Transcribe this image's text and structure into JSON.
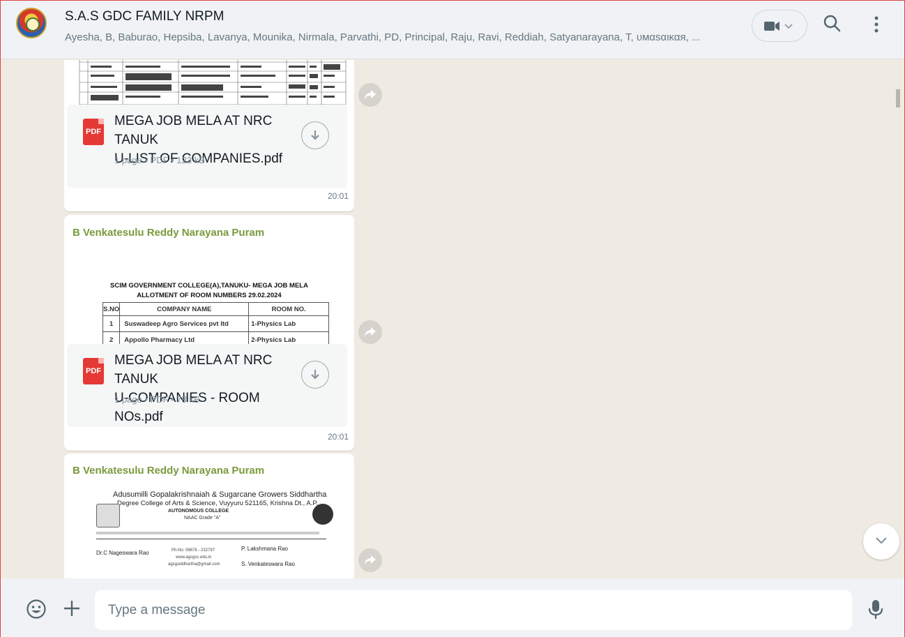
{
  "header": {
    "title": "S.A.S GDC FAMILY NRPM",
    "members": "Ayesha, B, Baburao, Hepsiba, Lavanya, Mounika, Nirmala, Parvathi, PD, Principal, Raju, Ravi, Reddiah, Satyanarayana, T, υмαsαικαя, ...",
    "icons": {
      "video": "video-camera-icon",
      "search": "search-icon",
      "menu": "kebab-menu-icon"
    }
  },
  "messages": [
    {
      "document": {
        "name_line1": "MEGA JOB MELA AT NRC TANUK",
        "name_line2": "U-LIST OF COMPANIES.pdf",
        "meta": "1 page • PDF • 123 kB",
        "badge": "PDF"
      },
      "time": "20:01"
    },
    {
      "sender": "B Venkatesulu Reddy Narayana Puram",
      "preview": {
        "heading1": "SCIM GOVERNMENT COLLEGE(A),TANUKU- MEGA JOB MELA",
        "heading2": "ALLOTMENT OF ROOM NUMBERS 29.02.2024",
        "col_sno": "S.NO",
        "col_company": "COMPANY NAME",
        "col_room": "ROOM NO.",
        "rows": [
          {
            "sno": "1",
            "company": "Suswadeep Agro Services pvt ltd",
            "room": "1-Physics Lab"
          },
          {
            "sno": "2",
            "company": "Appollo Pharmacy Ltd",
            "room": "2-Physics Lab"
          }
        ]
      },
      "document": {
        "name_line1": "MEGA JOB MELA AT NRC TANUK",
        "name_line2": "U-COMPANIES - ROOM NOs.pdf",
        "meta": "1 page • PDF • 78 kB",
        "badge": "PDF"
      },
      "time": "20:01"
    },
    {
      "sender": "B Venkatesulu Reddy Narayana Puram",
      "preview": {
        "line1": "Adusumilli Gopalakrishnaiah & Sugarcane Growers Siddhartha",
        "line2": "Degree College of Arts & Science, Vuyyuru 521165, Krishna Dt., A.P.",
        "line3": "AUTONOMOUS COLLEGE",
        "line4": "NAAC Grade \"A\"",
        "left_name": "Dr.C Nageswara Rao",
        "mid_phone": "Ph.No: 08676 - 232797",
        "mid_web": "www.agsgsc.edu.in",
        "mid_email": "agsgsiddhartha@gmail.com",
        "right_name1": "P. Lakshmana Rao",
        "right_name2": "S. Venkateswara Rao"
      }
    }
  ],
  "composer": {
    "placeholder": "Type a message",
    "icons": {
      "emoji": "emoji-icon",
      "attach": "plus-icon",
      "mic": "microphone-icon"
    }
  }
}
